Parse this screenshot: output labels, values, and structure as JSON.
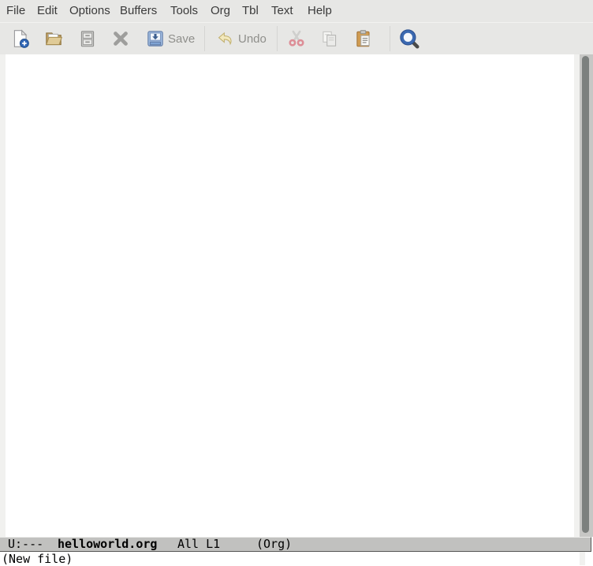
{
  "menubar": {
    "items": [
      {
        "label": "File"
      },
      {
        "label": "Edit"
      },
      {
        "label": "Options"
      },
      {
        "label": "Buffers"
      },
      {
        "label": "Tools"
      },
      {
        "label": "Org"
      },
      {
        "label": "Tbl"
      },
      {
        "label": "Text"
      },
      {
        "label": "Help"
      }
    ]
  },
  "toolbar": {
    "buttons": [
      {
        "name": "new-file",
        "icon": "new-file-icon"
      },
      {
        "name": "open-file",
        "icon": "open-folder-icon"
      },
      {
        "name": "dired",
        "icon": "file-cabinet-icon"
      },
      {
        "name": "kill-buffer",
        "icon": "close-icon"
      },
      {
        "name": "save-buffer",
        "icon": "save-icon",
        "label": "Save"
      },
      {
        "name": "undo",
        "icon": "undo-icon",
        "label": "Undo"
      },
      {
        "name": "cut",
        "icon": "cut-scissors-icon"
      },
      {
        "name": "copy",
        "icon": "copy-icon"
      },
      {
        "name": "paste",
        "icon": "paste-clipboard-icon"
      },
      {
        "name": "search",
        "icon": "search-icon"
      }
    ]
  },
  "buffer": {
    "content": ""
  },
  "modeline": {
    "status": "U:---",
    "buffer_name": "helloworld.org",
    "position": "All L1",
    "mode": "(Org)"
  },
  "echo_area": {
    "message": "(New file)"
  },
  "colors": {
    "chrome_bg": "#e7e7e5",
    "modeline_bg": "#c1c1bf",
    "fringe": "#f1f1ef",
    "scrollbar_trough": "#c7c7c5",
    "scrollbar_thumb": "#7c807e",
    "accent_blue": "#3b69b0",
    "disabled_label": "#8f8f8b"
  }
}
